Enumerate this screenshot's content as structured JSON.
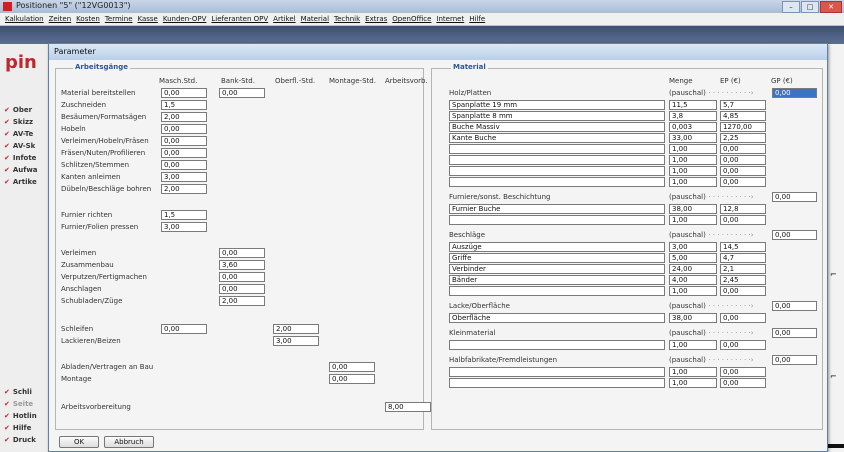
{
  "window": {
    "title": "Positionen \"5\" (\"12VG0013\")"
  },
  "menu": [
    "Kalkulation",
    "Zeiten",
    "Kosten",
    "Termine",
    "Kasse",
    "Kunden-OPV",
    "Lieferanten OPV",
    "Artikel",
    "Material",
    "Technik",
    "Extras",
    "OpenOffice",
    "Internet",
    "Hilfe"
  ],
  "logo": "pin",
  "nav_top": [
    "Ober",
    "Skizz",
    "AV-Te",
    "AV-Sk",
    "Infote",
    "Aufwa",
    "Artike"
  ],
  "nav_bottom": [
    "Schli",
    "Seite",
    "Hotlin",
    "Hilfe",
    "Druck"
  ],
  "dialog": {
    "title": "Parameter",
    "left": {
      "legend": "Arbeitsgänge",
      "headers": [
        "Masch.Std.",
        "Bank-Std.",
        "Oberfl.-Std.",
        "Montage-Std.",
        "Arbeitsvorb."
      ],
      "rows": [
        {
          "label": "Material bereitstellen",
          "values": [
            "0,00",
            "0,00",
            "",
            "",
            ""
          ]
        },
        {
          "label": "Zuschneiden",
          "values": [
            "1,5",
            "",
            "",
            "",
            ""
          ]
        },
        {
          "label": "Besäumen/Formatsägen",
          "values": [
            "2,00",
            "",
            "",
            "",
            ""
          ]
        },
        {
          "label": "Hobeln",
          "values": [
            "0,00",
            "",
            "",
            "",
            ""
          ]
        },
        {
          "label": "Verleimen/Hobeln/Fräsen",
          "values": [
            "0,00",
            "",
            "",
            "",
            ""
          ]
        },
        {
          "label": "Fräsen/Nuten/Profilieren",
          "values": [
            "0,00",
            "",
            "",
            "",
            ""
          ]
        },
        {
          "label": "Schlitzen/Stemmen",
          "values": [
            "0,00",
            "",
            "",
            "",
            ""
          ]
        },
        {
          "label": "Kanten anleimen",
          "values": [
            "3,00",
            "",
            "",
            "",
            ""
          ]
        },
        {
          "label": "Dübeln/Beschläge bohren",
          "values": [
            "2,00",
            "",
            "",
            "",
            ""
          ]
        },
        {
          "label": "Furnier richten",
          "values": [
            "1,5",
            "",
            "",
            "",
            ""
          ]
        },
        {
          "label": "Furnier/Folien pressen",
          "values": [
            "3,00",
            "",
            "",
            "",
            ""
          ]
        },
        {
          "label": "Verleimen",
          "values": [
            "",
            "0,00",
            "",
            "",
            ""
          ]
        },
        {
          "label": "Zusammenbau",
          "values": [
            "",
            "3,60",
            "",
            "",
            ""
          ]
        },
        {
          "label": "Verputzen/Fertigmachen",
          "values": [
            "",
            "0,00",
            "",
            "",
            ""
          ]
        },
        {
          "label": "Anschlagen",
          "values": [
            "",
            "0,00",
            "",
            "",
            ""
          ]
        },
        {
          "label": "Schubladen/Züge",
          "values": [
            "",
            "2,00",
            "",
            "",
            ""
          ]
        },
        {
          "label": "Schleifen",
          "values": [
            "0,00",
            "",
            "2,00",
            "",
            ""
          ]
        },
        {
          "label": "Lackieren/Beizen",
          "values": [
            "",
            "",
            "3,00",
            "",
            ""
          ]
        },
        {
          "label": "Abladen/Vertragen an Bau",
          "values": [
            "",
            "",
            "",
            "0,00",
            ""
          ]
        },
        {
          "label": "Montage",
          "values": [
            "",
            "",
            "",
            "0,00",
            ""
          ]
        },
        {
          "label": "Arbeitsvorbereitung",
          "values": [
            "",
            "",
            "",
            "",
            "8,00"
          ]
        }
      ]
    },
    "right": {
      "legend": "Material",
      "headers": [
        "Menge",
        "EP (€)",
        "GP (€)"
      ],
      "groups": [
        {
          "name": "Holz/Platten",
          "unit": "(pauschal)",
          "gp": "0,00",
          "items": [
            {
              "name": "Spanplatte 19 mm",
              "menge": "11,5",
              "ep": "5,7"
            },
            {
              "name": "Spanplatte 8 mm",
              "menge": "3,8",
              "ep": "4,85"
            },
            {
              "name": "Buche Massiv",
              "menge": "0,003",
              "ep": "1270,00"
            },
            {
              "name": "Kante Buche",
              "menge": "33,00",
              "ep": "2,25"
            },
            {
              "name": "",
              "menge": "1,00",
              "ep": "0,00"
            },
            {
              "name": "",
              "menge": "1,00",
              "ep": "0,00"
            },
            {
              "name": "",
              "menge": "1,00",
              "ep": "0,00"
            },
            {
              "name": "",
              "menge": "1,00",
              "ep": "0,00"
            }
          ]
        },
        {
          "name": "Furniere/sonst. Beschichtung",
          "unit": "(pauschal)",
          "gp": "0,00",
          "items": [
            {
              "name": "Furnier Buche",
              "menge": "38,00",
              "ep": "12,8"
            },
            {
              "name": "",
              "menge": "1,00",
              "ep": "0,00"
            }
          ]
        },
        {
          "name": "Beschläge",
          "unit": "(pauschal)",
          "gp": "0,00",
          "items": [
            {
              "name": "Auszüge",
              "menge": "3,00",
              "ep": "14,5"
            },
            {
              "name": "Griffe",
              "menge": "5,00",
              "ep": "4,7"
            },
            {
              "name": "Verbinder",
              "menge": "24,00",
              "ep": "2,1"
            },
            {
              "name": "Bänder",
              "menge": "4,00",
              "ep": "2,45"
            },
            {
              "name": "",
              "menge": "1,00",
              "ep": "0,00"
            }
          ]
        },
        {
          "name": "Lacke/Oberfläche",
          "unit": "(pauschal)",
          "gp": "0,00",
          "items": [
            {
              "name": "Oberfläche",
              "menge": "38,00",
              "ep": "0,00"
            }
          ]
        },
        {
          "name": "Kleinmaterial",
          "unit": "(pauschal)",
          "gp": "0,00",
          "items": [
            {
              "name": "",
              "menge": "1,00",
              "ep": "0,00"
            }
          ]
        },
        {
          "name": "Halbfabrikate/Fremdleistungen",
          "unit": "(pauschal)",
          "gp": "0,00",
          "items": [
            {
              "name": "",
              "menge": "1,00",
              "ep": "0,00"
            },
            {
              "name": "",
              "menge": "1,00",
              "ep": "0,00"
            }
          ]
        }
      ]
    },
    "buttons": {
      "ok": "OK",
      "cancel": "Abbruch"
    }
  }
}
